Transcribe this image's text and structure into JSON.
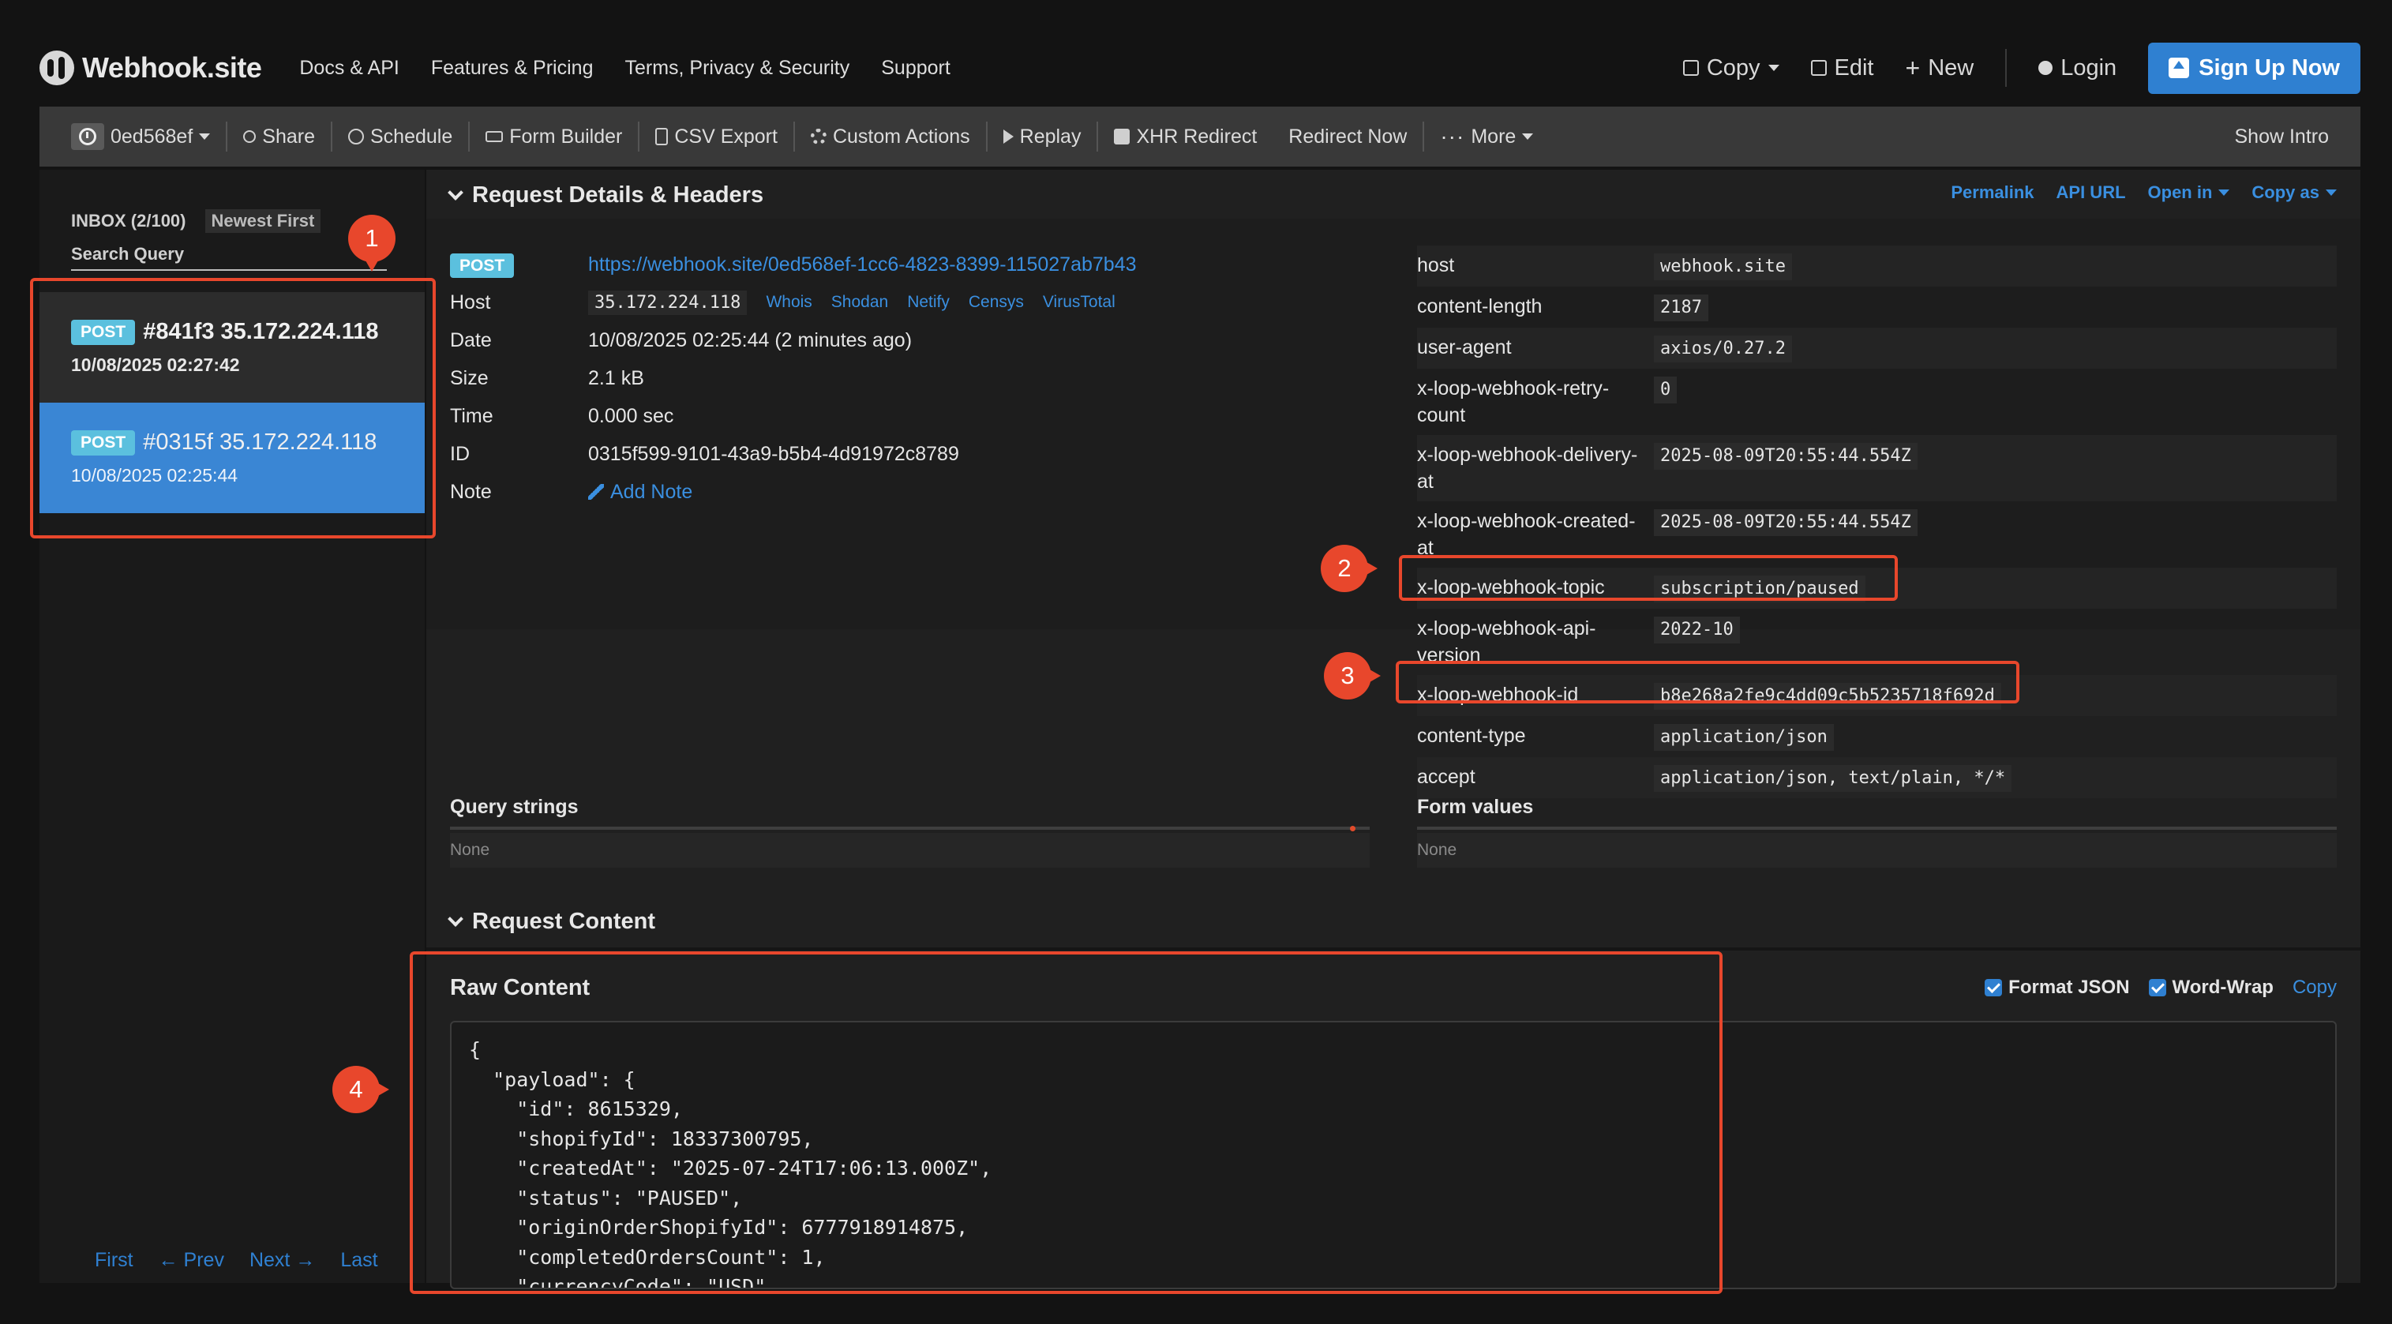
{
  "brand": {
    "name": "Webhook.site",
    "logo_icon": "webhook-logo-icon"
  },
  "nav": {
    "links": [
      "Docs & API",
      "Features & Pricing",
      "Terms, Privacy & Security",
      "Support"
    ],
    "copy": "Copy",
    "edit": "Edit",
    "new": "New",
    "login": "Login",
    "signup": "Sign Up Now"
  },
  "toolbar": {
    "token": "0ed568ef",
    "share": "Share",
    "schedule": "Schedule",
    "form_builder": "Form Builder",
    "csv_export": "CSV Export",
    "custom_actions": "Custom Actions",
    "replay": "Replay",
    "xhr_redirect": "XHR Redirect",
    "redirect_now": "Redirect Now",
    "more": "More",
    "show_intro": "Show Intro"
  },
  "sidebar": {
    "inbox": "INBOX (2/100)",
    "sort": "Newest First",
    "search_placeholder": "Search Query",
    "requests": [
      {
        "method": "POST",
        "title": "#841f3 35.172.224.118",
        "date": "10/08/2025 02:27:42"
      },
      {
        "method": "POST",
        "title": "#0315f 35.172.224.118",
        "date": "10/08/2025 02:25:44"
      }
    ],
    "pager": {
      "first": "First",
      "prev": "← Prev",
      "next": "Next →",
      "last": "Last"
    }
  },
  "details": {
    "section_title": "Request Details & Headers",
    "header_links": {
      "permalink": "Permalink",
      "api_url": "API URL",
      "open_in": "Open in",
      "copy_as": "Copy as"
    },
    "method": "POST",
    "url": "https://webhook.site/0ed568ef-1cc6-4823-8399-115027ab7b43",
    "host_label": "Host",
    "host": "35.172.224.118",
    "host_links": [
      "Whois",
      "Shodan",
      "Netify",
      "Censys",
      "VirusTotal"
    ],
    "date_label": "Date",
    "date": "10/08/2025 02:25:44 (2 minutes ago)",
    "size_label": "Size",
    "size": "2.1 kB",
    "time_label": "Time",
    "time": "0.000 sec",
    "id_label": "ID",
    "id": "0315f599-9101-43a9-b5b4-4d91972c8789",
    "note_label": "Note",
    "add_note": "Add Note",
    "headers": [
      {
        "key": "host",
        "value": "webhook.site"
      },
      {
        "key": "content-length",
        "value": "2187"
      },
      {
        "key": "user-agent",
        "value": "axios/0.27.2"
      },
      {
        "key": "x-loop-webhook-retry-count",
        "value": "0"
      },
      {
        "key": "x-loop-webhook-delivery-at",
        "value": "2025-08-09T20:55:44.554Z"
      },
      {
        "key": "x-loop-webhook-created-at",
        "value": "2025-08-09T20:55:44.554Z"
      },
      {
        "key": "x-loop-webhook-topic",
        "value": "subscription/paused"
      },
      {
        "key": "x-loop-webhook-api-version",
        "value": "2022-10"
      },
      {
        "key": "x-loop-webhook-id",
        "value": "b8e268a2fe9c4dd09c5b5235718f692d"
      },
      {
        "key": "content-type",
        "value": "application/json"
      },
      {
        "key": "accept",
        "value": "application/json, text/plain, */*"
      }
    ],
    "query_strings": {
      "title": "Query strings",
      "value": "None"
    },
    "form_values": {
      "title": "Form values",
      "value": "None"
    }
  },
  "content": {
    "section_title": "Request Content",
    "raw_title": "Raw Content",
    "format_json": "Format JSON",
    "word_wrap": "Word-Wrap",
    "copy": "Copy",
    "lines": [
      "{",
      "  \"payload\": {",
      "    \"id\": 8615329,",
      "    \"shopifyId\": 18337300795,",
      "    \"createdAt\": \"2025-07-24T17:06:13.000Z\",",
      "    \"status\": \"PAUSED\",",
      "    \"originOrderShopifyId\": 6777918914875,",
      "    \"completedOrdersCount\": 1,",
      "    \"currencyCode\": \"USD\","
    ]
  },
  "annotations": [
    "1",
    "2",
    "3",
    "4"
  ],
  "colors": {
    "accent": "#2f80d1",
    "annotation": "#e8472c",
    "badge": "#5bc0de"
  }
}
